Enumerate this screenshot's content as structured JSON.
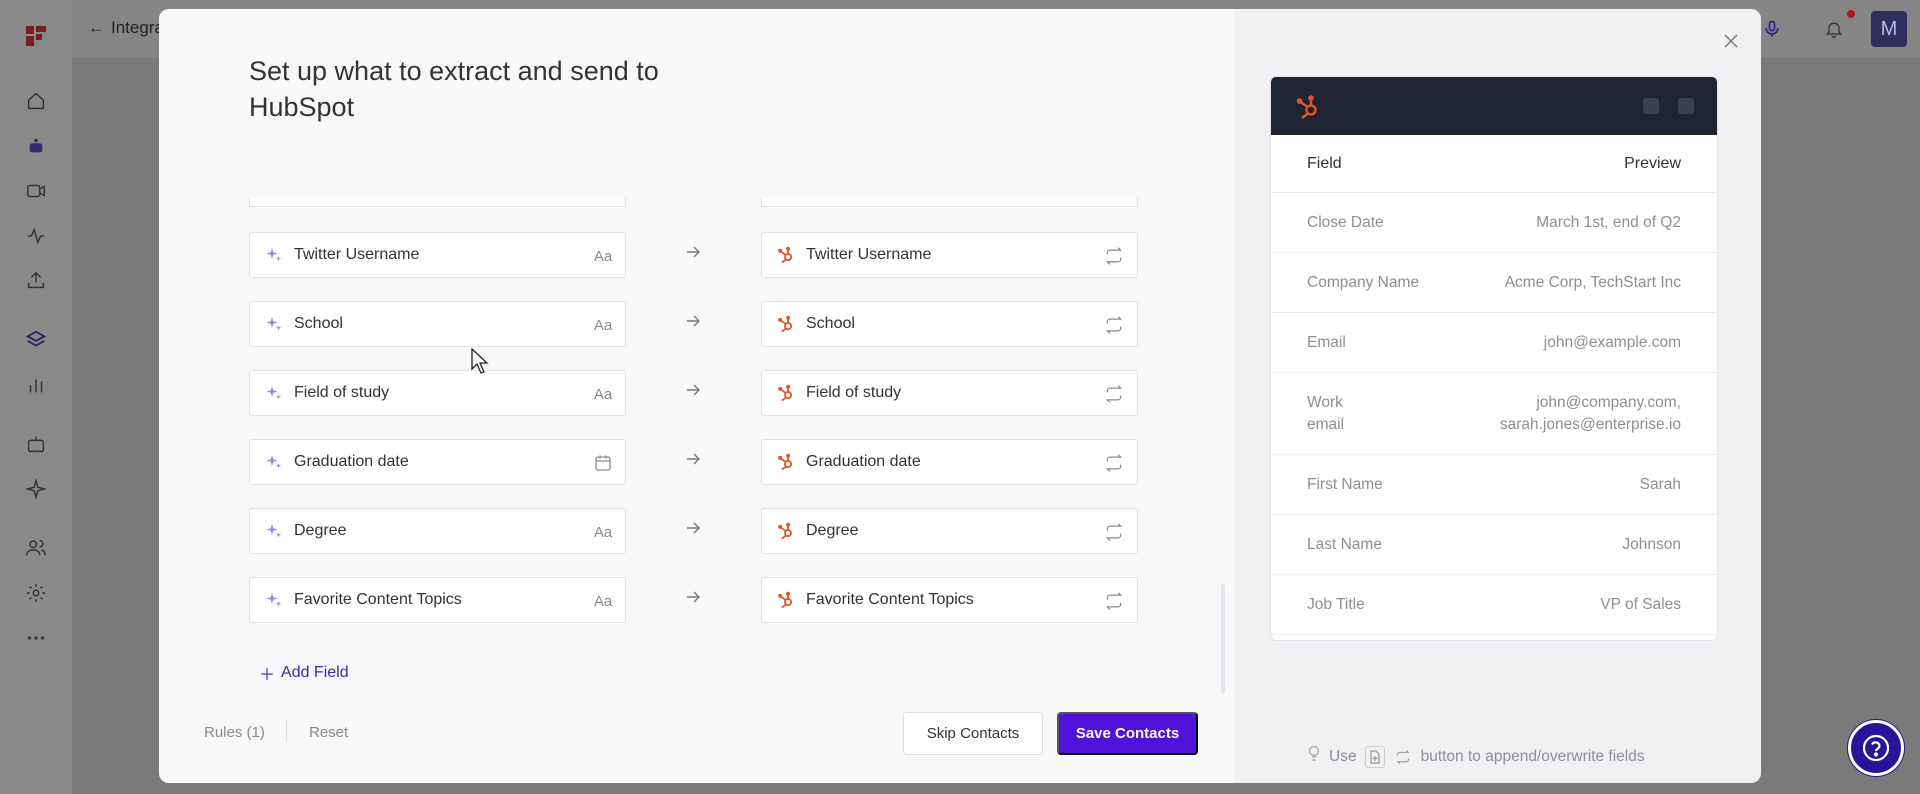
{
  "background": {
    "back_label": "Integra",
    "avatar_initial": "M",
    "sidebar_icons": [
      "home-icon",
      "bot-icon",
      "video-icon",
      "activity-icon",
      "upload-icon",
      "layers-icon",
      "bar-chart-icon",
      "robot-icon",
      "sparkle-icon",
      "users-icon",
      "settings-icon",
      "more-icon"
    ]
  },
  "modal": {
    "title": "Set up what to extract and send to HubSpot",
    "rows": [
      {
        "source": "Twitter Username",
        "source_type": "text-type-icon",
        "target": "Twitter Username"
      },
      {
        "source": "School",
        "source_type": "text-type-icon",
        "target": "School"
      },
      {
        "source": "Field of study",
        "source_type": "text-type-icon",
        "target": "Field of study"
      },
      {
        "source": "Graduation date",
        "source_type": "calendar-icon",
        "target": "Graduation date"
      },
      {
        "source": "Degree",
        "source_type": "text-type-icon",
        "target": "Degree"
      },
      {
        "source": "Favorite Content Topics",
        "source_type": "text-type-icon",
        "target": "Favorite Content Topics"
      }
    ],
    "text_type_glyph": "Aa",
    "add_field_label": "Add Field",
    "rules_label": "Rules (1)",
    "reset_label": "Reset",
    "skip_label": "Skip Contacts",
    "save_label": "Save Contacts"
  },
  "preview": {
    "header": {
      "field": "Field",
      "preview": "Preview"
    },
    "rows": [
      {
        "key": "Close Date",
        "value": "March 1st, end of Q2"
      },
      {
        "key": "Company Name",
        "value": "Acme Corp, TechStart Inc"
      },
      {
        "key": "Email",
        "value": "john@example.com"
      },
      {
        "key": "Work email",
        "value": "john@company.com, sarah.jones@enterprise.io"
      },
      {
        "key": "First Name",
        "value": "Sarah"
      },
      {
        "key": "Last Name",
        "value": "Johnson"
      },
      {
        "key": "Job Title",
        "value": "VP of Sales"
      }
    ]
  },
  "hint": {
    "use_label": "Use",
    "suffix": "button to append/overwrite fields"
  },
  "colors": {
    "accent": "#5012d8",
    "hubspot": "#e2552b",
    "link": "#4324b5"
  }
}
